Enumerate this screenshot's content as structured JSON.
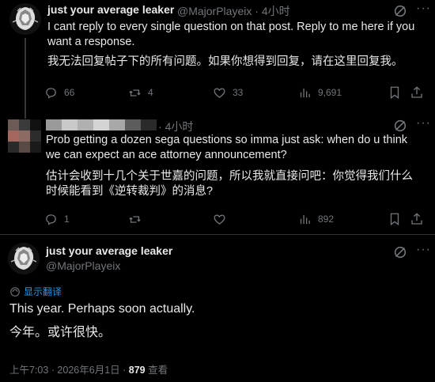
{
  "tweet1": {
    "name": "just your average leaker",
    "handle": "@MajorPlayeix",
    "time": "4小时",
    "text_en": "I cant reply to every single question on that post. Reply to me here if you want a response.",
    "text_cn": "我无法回复帖子下的所有问题。如果你想得到回复，请在这里回复我。",
    "replies": "66",
    "reposts": "4",
    "likes": "33",
    "views": "9,691"
  },
  "tweet2": {
    "time": "4小时",
    "text_en": "Prob getting a dozen sega questions so imma just ask: when do u think we can expect an ace attorney announcement?",
    "text_cn": "估计会收到十几个关于世嘉的问题，所以我就直接问吧：你觉得我们什么时候能看到《逆转裁判》的消息?",
    "replies": "1",
    "reposts": "",
    "likes": "",
    "views": "892"
  },
  "tweet3": {
    "name": "just your average leaker",
    "handle": "@MajorPlayeix",
    "translate_label": "显示翻译",
    "text_en": "This year. Perhaps soon actually.",
    "text_cn": "今年。或许很快。",
    "timestamp": "上午7:03 · 2026年6月1日 · ",
    "views_count": "879",
    "views_label": " 查看"
  },
  "colors": {
    "background": "#000000",
    "text": "#e7e9ea",
    "secondary": "#71767b",
    "accent": "#1d9bf0",
    "border": "#2f3336"
  },
  "icons": {
    "reply": "reply-icon",
    "repost": "repost-icon",
    "like": "heart-icon",
    "views": "views-icon",
    "bookmark": "bookmark-icon",
    "share": "share-icon",
    "grok": "grok-icon",
    "more": "more-icon",
    "translate": "translate-icon"
  }
}
